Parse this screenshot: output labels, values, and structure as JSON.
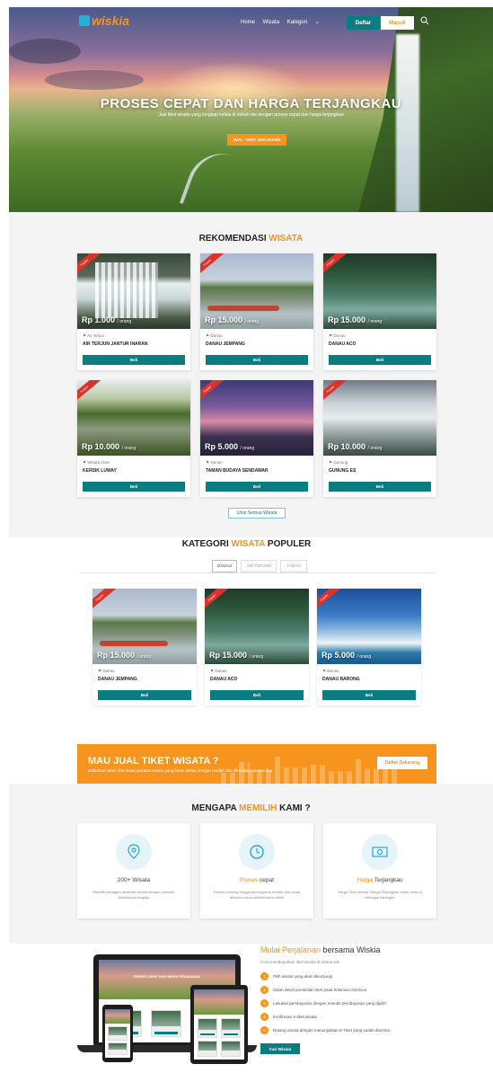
{
  "nav": {
    "logo_text": "wiskia",
    "links": [
      "Home",
      "Wisata",
      "Kategori"
    ],
    "daftar": "Daftar",
    "masuk": "Masuk"
  },
  "hero": {
    "title": "PROSES CEPAT DAN HARGA TERJANGKAU",
    "subtitle": "Jual tiket wisata yang lengkap kelola di sekali site dengan proses cepat dan harga terjangkau",
    "cta": "JUAL TIKET SEKARANG"
  },
  "rekomendasi": {
    "title_pre": "REKOMENDASI",
    "title_hl": "WISATA",
    "ribbon": "Populer",
    "per": "/ orang",
    "beli": "Beli",
    "cards": [
      {
        "price": "Rp 1.000",
        "loc": "Air Terjun",
        "name": "AIR TERJUN JANTUR INARAN"
      },
      {
        "price": "Rp 15.000",
        "loc": "Danau",
        "name": "DANAU JEMPANG"
      },
      {
        "price": "Rp 15.000",
        "loc": "Danau",
        "name": "DANAU ACO"
      },
      {
        "price": "Rp 10.000",
        "loc": "Wisata Alam",
        "name": "KERSIK LUWAY"
      },
      {
        "price": "Rp 5.000",
        "loc": "Taman",
        "name": "TAMAN BUDAYA SENDAWAR"
      },
      {
        "price": "Rp 10.000",
        "loc": "Gunung",
        "name": "GUNUNG ES"
      }
    ],
    "lihat_semua": "Lihat Semua Wisata"
  },
  "kategori": {
    "title_pre": "KATEGORI",
    "title_hl": "WISATA",
    "title_post": "POPULER",
    "tabs": [
      "DANAU",
      "AIR TERJUN",
      "TAMAN"
    ],
    "cards": [
      {
        "price": "Rp 15.000",
        "loc": "Danau",
        "name": "DANAU JEMPANG"
      },
      {
        "price": "Rp 15.000",
        "loc": "Danau",
        "name": "DANAU ACO"
      },
      {
        "price": "Rp 5.000",
        "loc": "Danau",
        "name": "DANAU BARONG"
      }
    ]
  },
  "banner": {
    "title": "MAU JUAL TIKET WISATA ?",
    "subtitle": "Daftarkan kamu dan mulai jual tiket wisata yang kamu kelola dengan mudah dan dilengkapi proses fitur",
    "button": "Daftar Sekarang"
  },
  "mengapa": {
    "title_pre": "MENGAPA",
    "title_hl": "MEMILIH",
    "title_post": "KAMI ?",
    "items": [
      {
        "t_hl": "",
        "t_rest": "200+ Wisata",
        "desc": "Memiliki beragam destinasi wisata dengan menarik, fasilitasnya lengkap"
      },
      {
        "t_hl": "Proses",
        "t_rest": " cepat",
        "desc": "Proses booking hingga pembayaran mudah dan cepat dibayar cukup setelah kamu disini"
      },
      {
        "t_hl": "Harga",
        "t_rest": " Terjangkau",
        "desc": "Harga Tiket Wisata Sangat Terjangkau untuk anda di berbagai kalangan"
      }
    ]
  },
  "mulai": {
    "title_hl": "Mulai Perjalanan",
    "title_rest": " bersama Wiskia",
    "subtitle": "Cara mendapatkan tiket wisata di wiskia.site",
    "steps": [
      "Pilih wisata yang akan dikunjungi",
      "Isikan detail pembelian tiket pada halaman checkout",
      "Lakukan pembayaran dengan metode pembayaran yang dipilih",
      "Konfirmasi e-tiket wisata",
      "Datang wisata dengan menunjukkan E-Tiket yang sudah diterima"
    ],
    "button": "Cari Wisata",
    "mini_title": "PROSES CEPAT DAN HARGA TERJANGKAU"
  },
  "colors": {
    "accent": "#f7941d",
    "teal": "#0b7c80",
    "ribbon": "#d9342b"
  }
}
